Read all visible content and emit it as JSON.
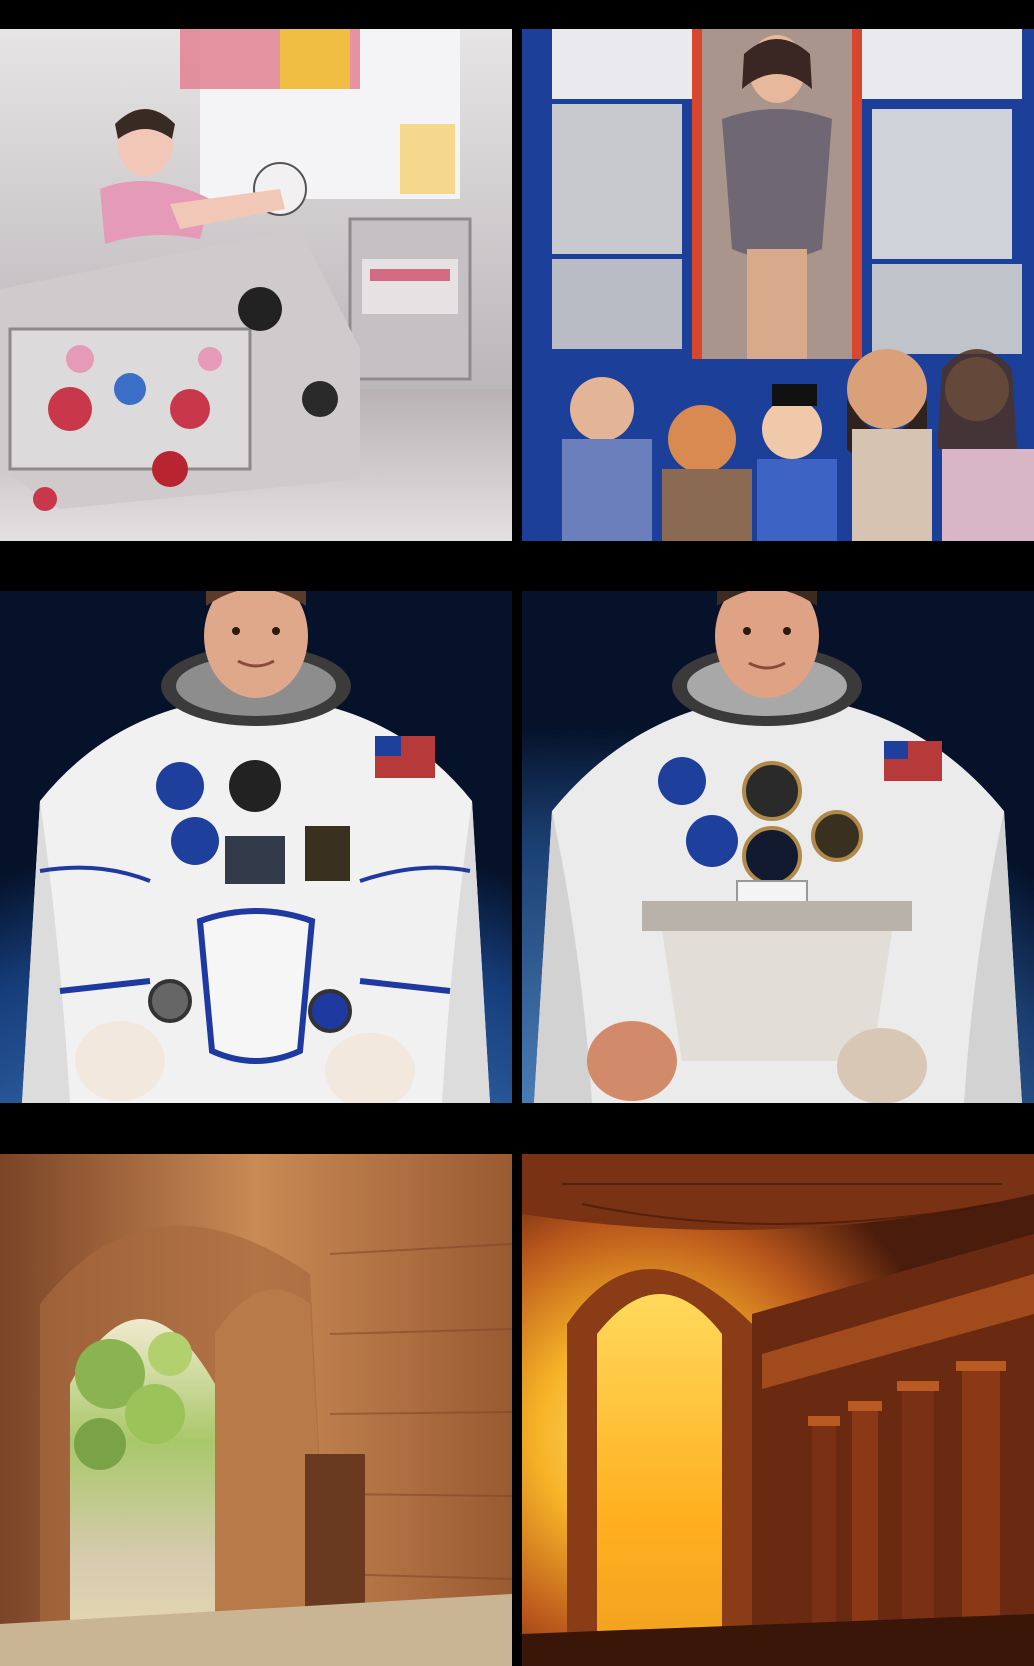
{
  "grid": {
    "rows": 3,
    "columns": 2,
    "background_color": "#000000"
  },
  "panels": [
    {
      "row": 0,
      "col": 0,
      "subject": "cluttered-bedroom-with-woman-and-plush-toys-illustration",
      "palette": [
        "#d9d6d9",
        "#b7b3b6",
        "#c9374a",
        "#e8c2d6"
      ]
    },
    {
      "row": 0,
      "col": 1,
      "subject": "colorful-collage-poster-with-people-and-shelves-illustration",
      "palette": [
        "#1c3f9a",
        "#d9462e",
        "#e6a27a",
        "#6b7fbd"
      ]
    },
    {
      "row": 1,
      "col": 0,
      "subject": "astronaut-portrait-blue-trim-suit-earth-background",
      "palette": [
        "#07142e",
        "#2d63a8",
        "#f1f1f1",
        "#1e3aa0"
      ]
    },
    {
      "row": 1,
      "col": 1,
      "subject": "astronaut-portrait-plain-white-suit-earth-background",
      "palette": [
        "#07142e",
        "#3a6ea8",
        "#e9e9e9",
        "#8b7a6a"
      ]
    },
    {
      "row": 2,
      "col": 0,
      "subject": "stone-arch-corridor-opening-to-green-garden",
      "palette": [
        "#9a5a32",
        "#c98a55",
        "#e9dcae",
        "#8ab450"
      ]
    },
    {
      "row": 2,
      "col": 1,
      "subject": "ornate-temple-corridor-with-glowing-golden-doorway",
      "palette": [
        "#5a2410",
        "#b8561c",
        "#f7b327",
        "#ffe07a"
      ]
    }
  ]
}
